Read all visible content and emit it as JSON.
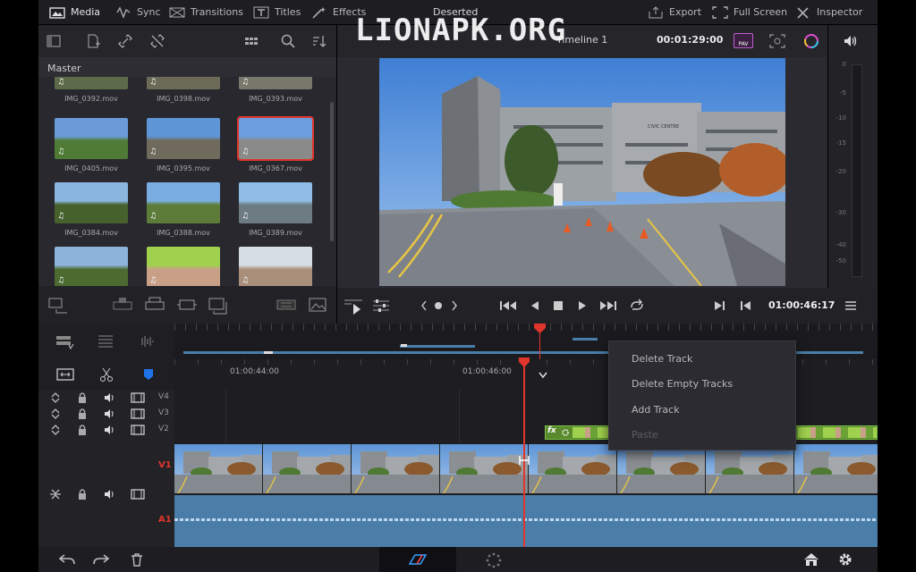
{
  "toolbar": {
    "items": [
      {
        "label": "Media",
        "icon": "media-icon",
        "active": true
      },
      {
        "label": "Sync",
        "icon": "sync-icon"
      },
      {
        "label": "Transitions",
        "icon": "transitions-icon"
      },
      {
        "label": "Titles",
        "icon": "titles-icon"
      },
      {
        "label": "Effects",
        "icon": "effects-icon"
      }
    ],
    "project_title": "Deserted",
    "right_items": [
      {
        "label": "Export",
        "icon": "export-icon"
      },
      {
        "label": "Full Screen",
        "icon": "fullscreen-icon"
      },
      {
        "label": "Inspector",
        "icon": "inspector-icon"
      }
    ]
  },
  "watermark": "LIONAPK.ORG",
  "media_pool": {
    "bin_label": "Master",
    "clips": [
      {
        "name": "IMG_0392.mov",
        "colors": [
          "#9aa7b6",
          "#5e6b4a"
        ]
      },
      {
        "name": "IMG_0398.mov",
        "colors": [
          "#a8b2bd",
          "#6c6b58"
        ]
      },
      {
        "name": "IMG_0393.mov",
        "colors": [
          "#b6c1cc",
          "#77776c"
        ]
      },
      {
        "name": "IMG_0405.mov",
        "colors": [
          "#6a9bd8",
          "#4f7b36"
        ]
      },
      {
        "name": "IMG_0395.mov",
        "colors": [
          "#5e95d6",
          "#6f6a5b"
        ]
      },
      {
        "name": "IMG_0367.mov",
        "colors": [
          "#6d9fde",
          "#8a8a8a"
        ],
        "selected": true
      },
      {
        "name": "IMG_0384.mov",
        "colors": [
          "#8bb6e0",
          "#47612d"
        ]
      },
      {
        "name": "IMG_0388.mov",
        "colors": [
          "#7aaee2",
          "#5d7c3a"
        ]
      },
      {
        "name": "IMG_0389.mov",
        "colors": [
          "#8fbde6",
          "#6d7b82"
        ]
      },
      {
        "name": "",
        "colors": [
          "#8cb3d9",
          "#4c6b30"
        ]
      },
      {
        "name": "",
        "colors": [
          "#9fd04e",
          "#c8a088"
        ]
      },
      {
        "name": "",
        "colors": [
          "#d7dde4",
          "#a98f7a"
        ]
      }
    ]
  },
  "viewer": {
    "timeline_name": "Timeline 1",
    "source_timecode": "00:01:29:00",
    "badge": "PAV",
    "timecode": "01:00:46:17"
  },
  "audio_meter": {
    "labels": [
      "0",
      "-5",
      "-10",
      "-15",
      "-20",
      "-30",
      "-40",
      "-50"
    ]
  },
  "timeline": {
    "ruler_labels": [
      "01:00:44:00",
      "01:00:46:00"
    ],
    "tracks": [
      {
        "label": "V4"
      },
      {
        "label": "V3"
      },
      {
        "label": "V2"
      },
      {
        "label": "V1"
      },
      {
        "label": "A1"
      }
    ],
    "fx_label": "fx"
  },
  "context_menu": {
    "items": [
      {
        "label": "Delete Track",
        "enabled": true
      },
      {
        "label": "Delete Empty Tracks",
        "enabled": true
      },
      {
        "label": "Add Track",
        "enabled": true
      },
      {
        "label": "Paste",
        "enabled": false
      }
    ]
  },
  "colors": {
    "accent_red": "#e0352b",
    "audio_blue": "#4a7ea8",
    "fx_green": "#7ac143",
    "panel": "#28282e"
  }
}
